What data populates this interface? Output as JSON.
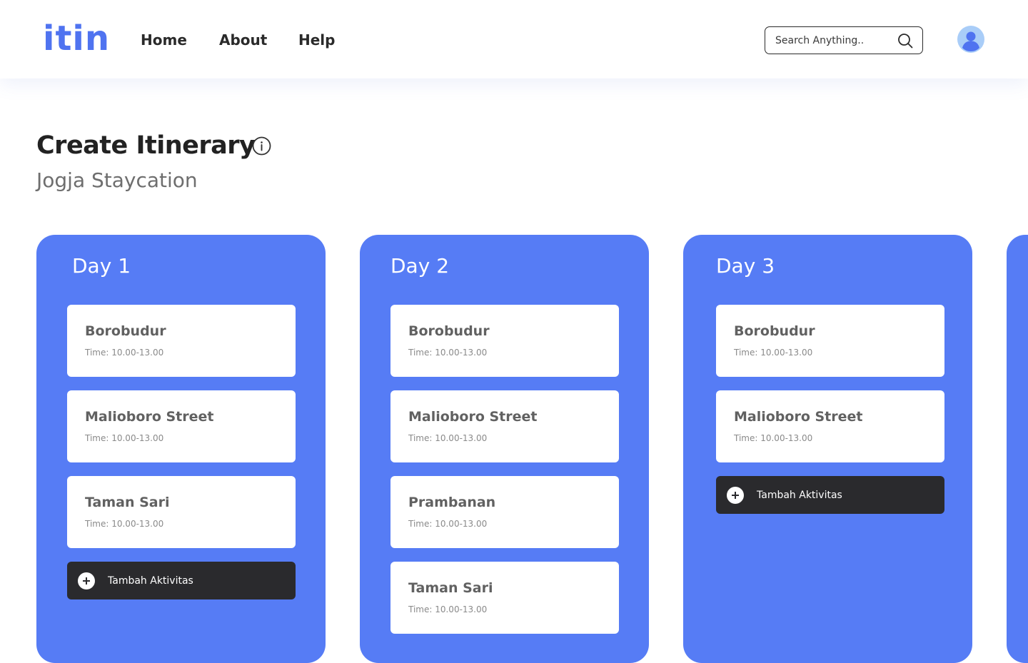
{
  "nav": {
    "logo": "itin",
    "links": [
      "Home",
      "About",
      "Help"
    ],
    "search_placeholder": "Search Anything.."
  },
  "page": {
    "title": "Create Itinerary",
    "subtitle": "Jogja Staycation"
  },
  "days": [
    {
      "title": "Day 1",
      "activities": [
        {
          "name": "Borobudur",
          "time": "Time: 10.00-13.00"
        },
        {
          "name": "Malioboro Street",
          "time": "Time: 10.00-13.00"
        },
        {
          "name": "Taman Sari",
          "time": "Time: 10.00-13.00"
        }
      ],
      "add_label": "Tambah Aktivitas"
    },
    {
      "title": "Day 2",
      "activities": [
        {
          "name": "Borobudur",
          "time": "Time: 10.00-13.00"
        },
        {
          "name": "Malioboro Street",
          "time": "Time: 10.00-13.00"
        },
        {
          "name": "Prambanan",
          "time": "Time: 10.00-13.00"
        },
        {
          "name": "Taman Sari",
          "time": "Time: 10.00-13.00"
        }
      ]
    },
    {
      "title": "Day 3",
      "activities": [
        {
          "name": "Borobudur",
          "time": "Time: 10.00-13.00"
        },
        {
          "name": "Malioboro Street",
          "time": "Time: 10.00-13.00"
        }
      ],
      "add_label": "Tambah Aktivitas"
    }
  ],
  "colors": {
    "brand": "#4f73f0",
    "day_column": "#567cf5",
    "add_button": "#2a2a2d",
    "avatar": "#a9cdf8"
  },
  "icons": [
    "search-icon",
    "user-avatar-icon",
    "info-icon",
    "plus-circle-icon"
  ]
}
